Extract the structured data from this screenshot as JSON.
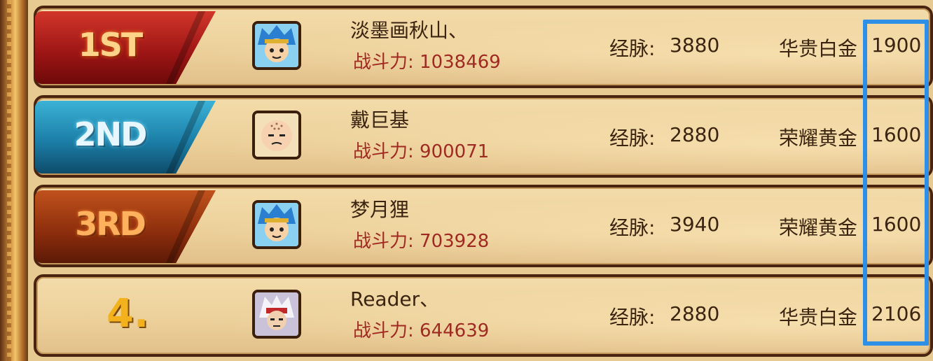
{
  "rows": [
    {
      "rank_label": "1ST",
      "name": "淡墨画秋山、",
      "power_label": "战斗力: ",
      "power_value": "1038469",
      "meridian_label": "经脉:",
      "meridian_value": "3880",
      "tier": "华贵白金",
      "score": "1900",
      "avatar_icon": "blue-hair-hero-avatar-icon"
    },
    {
      "rank_label": "2ND",
      "name": "戴巨基",
      "power_label": "战斗力: ",
      "power_value": "900071",
      "meridian_label": "经脉:",
      "meridian_value": "2880",
      "tier": "荣耀黄金",
      "score": "1600",
      "avatar_icon": "bald-monk-avatar-icon"
    },
    {
      "rank_label": "3RD",
      "name": "梦月狸",
      "power_label": "战斗力: ",
      "power_value": "703928",
      "meridian_label": "经脉:",
      "meridian_value": "3940",
      "tier": "荣耀黄金",
      "score": "1600",
      "avatar_icon": "blue-hair-hero-avatar-icon"
    },
    {
      "rank_label": "4.",
      "name": "Reader、",
      "power_label": "战斗力: ",
      "power_value": "644639",
      "meridian_label": "经脉:",
      "meridian_value": "2880",
      "tier": "华贵白金",
      "score": "2106",
      "avatar_icon": "white-hair-warrior-avatar-icon"
    }
  ],
  "colors": {
    "panel_bg": "#ecd09a",
    "power_text": "#a02a22",
    "highlight": "#2e8fe6",
    "rank1": "#9a1414",
    "rank2": "#1c7fa8",
    "rank3": "#8a2c0c"
  }
}
